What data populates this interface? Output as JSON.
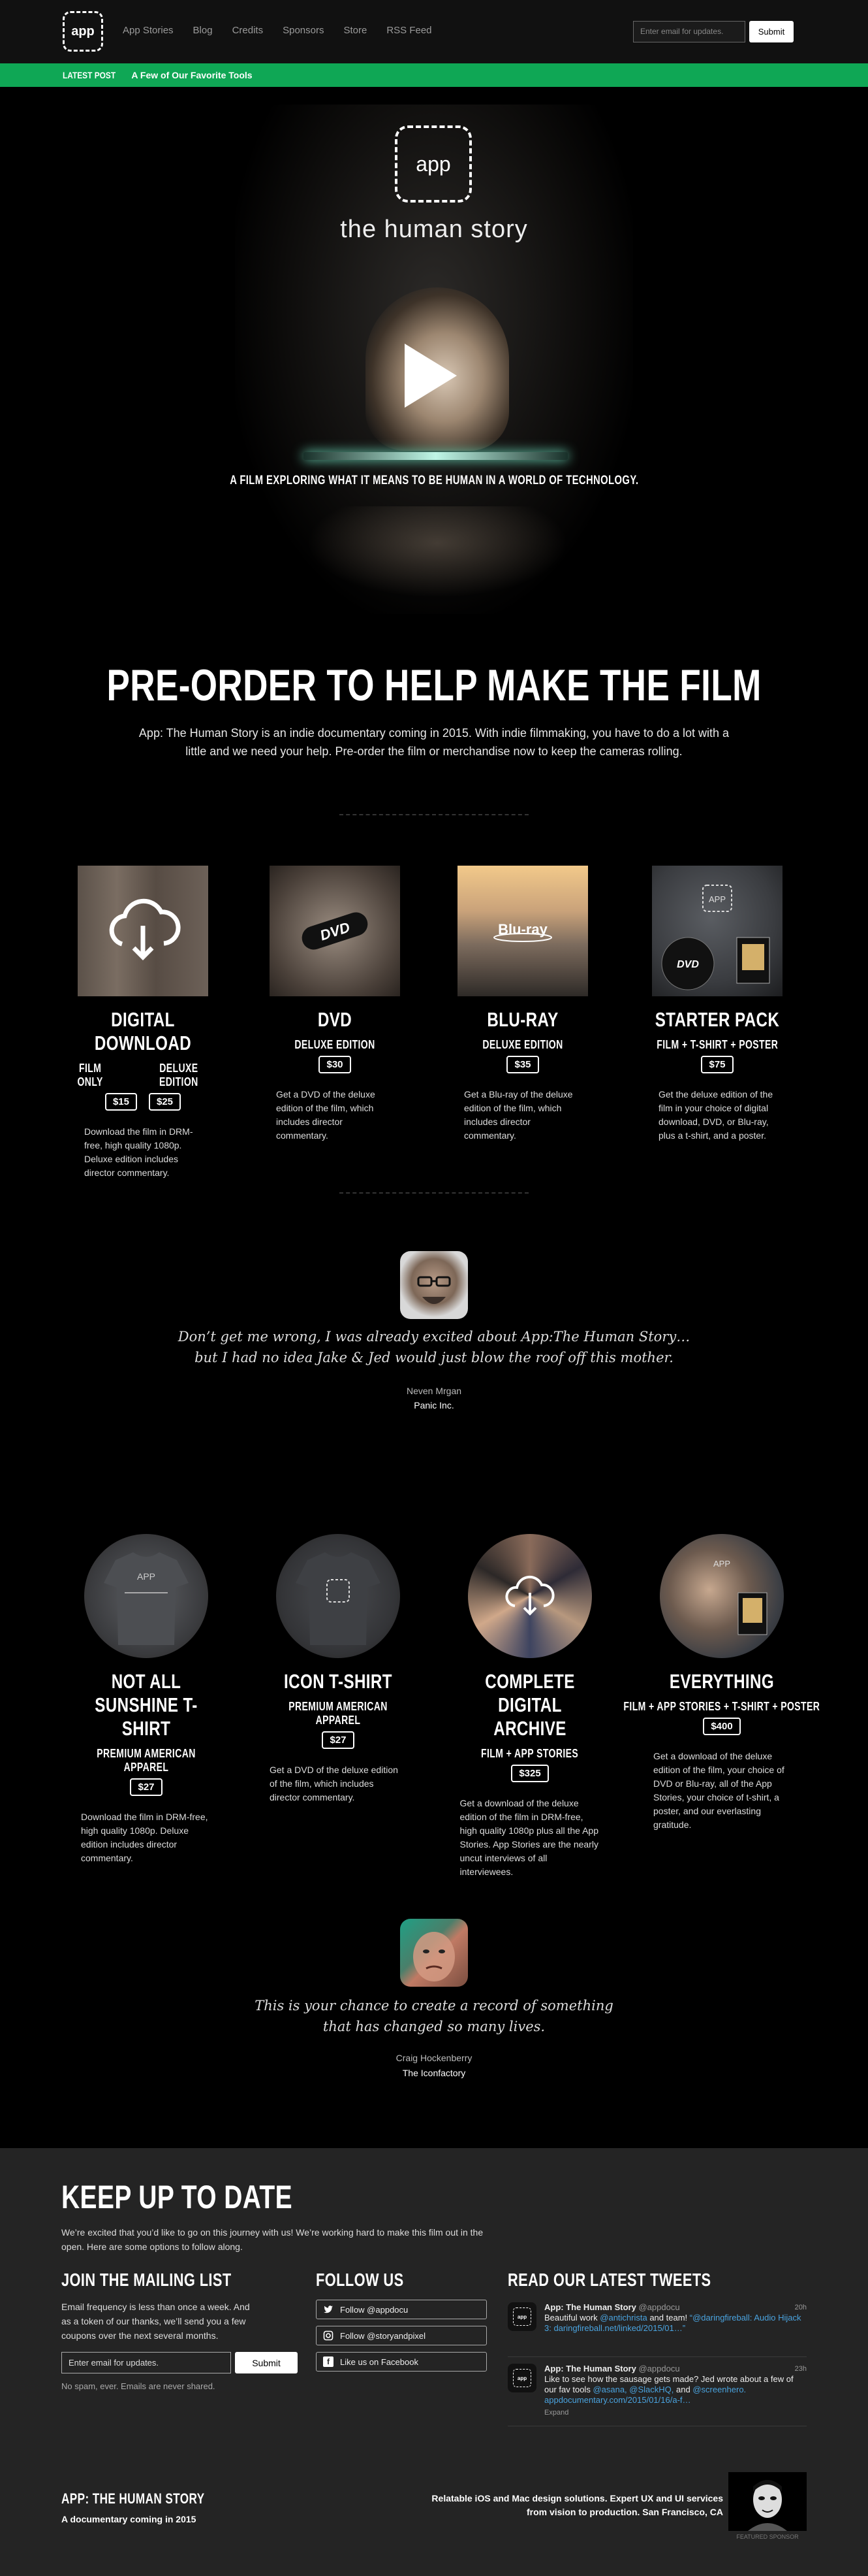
{
  "nav": {
    "logo": "app",
    "links": [
      "App Stories",
      "Blog",
      "Credits",
      "Sponsors",
      "Store",
      "RSS Feed"
    ],
    "email_placeholder": "Enter email for updates.",
    "submit": "Submit"
  },
  "latest": {
    "label": "LATEST POST",
    "title": "A Few of Our Favorite Tools"
  },
  "hero": {
    "logo": "app",
    "subtitle": "the human story",
    "caption": "A FILM EXPLORING WHAT IT MEANS TO BE HUMAN IN A WORLD OF TECHNOLOGY."
  },
  "preorder": {
    "heading": "PRE-ORDER TO HELP MAKE THE FILM",
    "intro": "App: The Human Story is an indie documentary coming in 2015. With indie filmmaking, you have to do a lot with a little and we need your help. Pre-order the film or merchandise now to keep the cameras rolling."
  },
  "products": [
    {
      "name": "DIGITAL DOWNLOAD",
      "subs": [
        "FILM ONLY",
        "DELUXE EDITION"
      ],
      "prices": [
        "$15",
        "$25"
      ],
      "desc": "Download the film in DRM-free, high quality 1080p. Deluxe edition includes director commentary.",
      "icon": "cloud-download-icon"
    },
    {
      "name": "DVD",
      "subs": [
        "DELUXE EDITION"
      ],
      "prices": [
        "$30"
      ],
      "desc": "Get a DVD of the deluxe edition of the film, which includes director commentary.",
      "icon": "dvd-icon"
    },
    {
      "name": "BLU-RAY",
      "subs": [
        "DELUXE EDITION"
      ],
      "prices": [
        "$35"
      ],
      "desc": "Get a Blu-ray of the deluxe edition of the film, which includes director commentary.",
      "icon": "bluray-icon"
    },
    {
      "name": "STARTER PACK",
      "subs": [
        "FILM + T-SHIRT + POSTER"
      ],
      "prices": [
        "$75"
      ],
      "desc": "Get the deluxe edition of the film in your choice of digital download, DVD, or Blu-ray, plus a t-shirt, and a poster.",
      "icon": "shirt-icon"
    }
  ],
  "quote1": {
    "line1": "Don’t get me wrong, I was already excited about App:The Human Story…",
    "line2": "but I had no idea Jake & Jed would just blow the roof off this mother.",
    "name": "Neven Mrgan",
    "company": "Panic Inc."
  },
  "products2": [
    {
      "name": "NOT ALL SUNSHINE T-SHIRT",
      "sub": "PREMIUM AMERICAN APPAREL",
      "price": "$27",
      "desc": "Download the film in DRM-free, high quality 1080p. Deluxe edition includes director commentary."
    },
    {
      "name": "ICON T-SHIRT",
      "sub": "PREMIUM AMERICAN APPAREL",
      "price": "$27",
      "desc": "Get a DVD of the deluxe edition of the film, which includes director commentary."
    },
    {
      "name": "COMPLETE DIGITAL ARCHIVE",
      "sub": "FILM + APP STORIES",
      "price": "$325",
      "desc": "Get a download of the deluxe edition of the film in DRM-free, high quality 1080p plus all the App Stories. App Stories are the nearly uncut interviews of all interviewees."
    },
    {
      "name": "EVERYTHING",
      "sub": "FILM + APP STORIES + T-SHIRT + POSTER",
      "price": "$400",
      "desc": "Get a download of the deluxe edition of the film, your choice of DVD or Blu-ray, all of the App Stories, your choice of t-shirt, a poster, and our everlasting gratitude."
    }
  ],
  "quote2": {
    "line1": "This is your chance to create a record of something",
    "line2": "that has changed so many lives.",
    "name": "Craig Hockenberry",
    "company": "The Iconfactory"
  },
  "footer": {
    "heading": "KEEP UP TO DATE",
    "intro": "We’re excited that you’d like to go on this journey with us! We’re working hard to make this film out in the open. Here are some options to follow along.",
    "mailing": {
      "heading": "JOIN THE MAILING LIST",
      "text": "Email frequency is less than once a week. And as a token of our thanks, we’ll send you a few coupons over the next several months.",
      "placeholder": "Enter email for updates.",
      "submit": "Submit",
      "note": "No spam, ever. Emails are never shared."
    },
    "follow": {
      "heading": "FOLLOW US",
      "buttons": [
        "Follow @appdocu",
        "Follow @storyandpixel",
        "Like us on Facebook"
      ]
    },
    "tweets": {
      "heading": "READ OUR LATEST TWEETS",
      "items": [
        {
          "name": "App: The Human Story",
          "handle": "@appdocu",
          "time": "20h",
          "pre": "Beautiful work ",
          "link1": "@antichrista",
          "mid": " and team! ",
          "link2": "“@daringfireball: Audio Hijack 3: daringfireball.net/linked/2015/01…”",
          "expand": ""
        },
        {
          "name": "App: The Human Story",
          "handle": "@appdocu",
          "time": "23h",
          "pre": "Like to see how the sausage gets made? Jed wrote about a few of our fav tools ",
          "link1": "@asana, @SlackHQ, ",
          "mid": "and ",
          "link2": "@screenhero. appdocumentary.com/2015/01/16/a-f…",
          "expand": "Expand"
        }
      ]
    },
    "bottom_title": "APP: THE HUMAN STORY",
    "bottom_sub": "A documentary coming in 2015",
    "sponsor_text": "Relatable iOS and Mac design solutions. Expert UX and UI services from vision to production. San Francisco, CA",
    "sponsor_label": "FEATURED SPONSOR"
  },
  "colors": {
    "accent_green": "#0fa755",
    "footer_bg": "#242424",
    "link": "#4aa3df"
  }
}
